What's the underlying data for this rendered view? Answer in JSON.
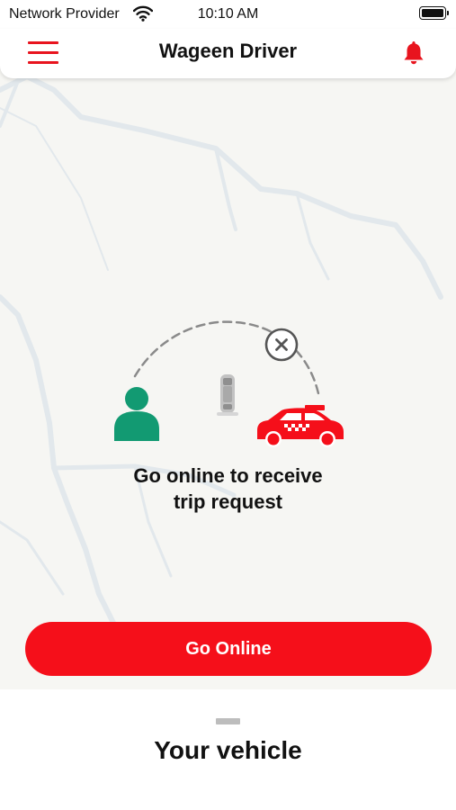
{
  "status_bar": {
    "carrier": "Network Provider",
    "time": "10:10 AM"
  },
  "header": {
    "title": "Wageen Driver"
  },
  "main": {
    "message_line1": "Go online to receive",
    "message_line2": "trip request",
    "go_online_label": "Go Online"
  },
  "bottom_sheet": {
    "title": "Your vehicle"
  },
  "colors": {
    "accent_red": "#f50f1a",
    "passenger_green": "#129a72"
  },
  "icons": {
    "menu": "hamburger-icon",
    "notifications": "bell-icon",
    "wifi": "wifi-icon",
    "battery": "battery-icon",
    "passenger": "person-icon",
    "car": "car-top-icon",
    "taxi": "taxi-icon",
    "cancel": "close-circle-icon"
  }
}
